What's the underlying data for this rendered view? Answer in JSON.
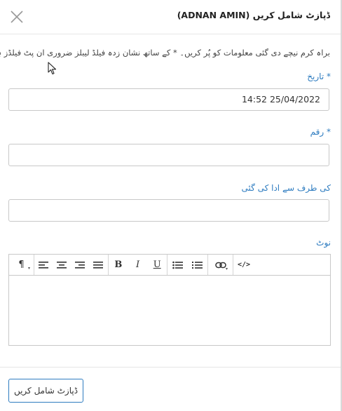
{
  "dialog": {
    "title": "ڈپازٹ شامل کریں (ADNAN AMIN)",
    "instructions": "براہ کرم نیچے دی گئی معلومات کو پُر کریں۔ * کے ساتھ نشان زدہ فیلڈ لیبلز ضروری ان پٹ فیلڈز ہیں۔"
  },
  "fields": {
    "date": {
      "label": "* تاریخ",
      "value": "14:52 25/04/2022"
    },
    "amount": {
      "label": "* رقم",
      "value": ""
    },
    "paid_by": {
      "label": "کی طرف سے ادا کی گئی",
      "value": ""
    },
    "note": {
      "label": "نوٹ",
      "value": ""
    }
  },
  "toolbar": {
    "paragraph": "¶",
    "bold": "B",
    "italic": "I",
    "underline": "U",
    "code": "</>"
  },
  "footer": {
    "submit_label": "ڈپازٹ شامل کریں"
  },
  "colors": {
    "accent": "#2e7cc0",
    "border": "#c8c8c8"
  }
}
